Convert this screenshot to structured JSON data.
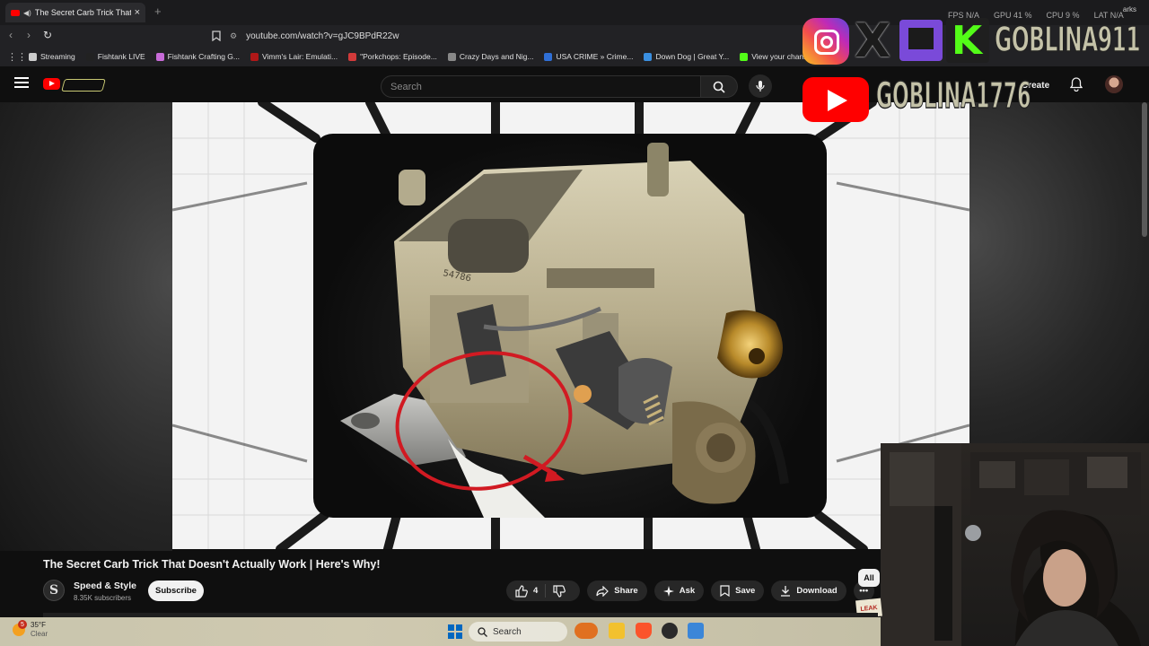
{
  "browser": {
    "tab_title": "The Secret Carb Trick That Doesn't Actually Work | Here's Why!",
    "url": "youtube.com/watch?v=gJC9BPdR22w",
    "bookmarks": [
      {
        "label": "Streaming",
        "color": "#cccccc"
      },
      {
        "label": "Fishtank LIVE",
        "color": "#222222"
      },
      {
        "label": "Fishtank Crafting G...",
        "color": "#c86bd8"
      },
      {
        "label": "Vimm's Lair: Emulati...",
        "color": "#b01818"
      },
      {
        "label": "\"Porkchops: Episode...",
        "color": "#d23a3a"
      },
      {
        "label": "Crazy Days and Nig...",
        "color": "#888888"
      },
      {
        "label": "USA CRIME » Crime...",
        "color": "#2f6fd6"
      },
      {
        "label": "Down Dog | Great Y...",
        "color": "#3a8fe0"
      },
      {
        "label": "View your channel",
        "color": "#53fc18"
      }
    ],
    "bookmarks_right": "arks"
  },
  "youtube": {
    "search_placeholder": "Search",
    "create_label": "Create"
  },
  "overlay": {
    "handle_primary": "GOBLINA911",
    "handle_youtube": "GOBLINA1776",
    "perf": {
      "fps": "FPS N/A",
      "gpu": "GPU 41 %",
      "cpu": "CPU 9 %",
      "lat": "LAT N/A"
    }
  },
  "video": {
    "title": "The Secret Carb Trick That Doesn't Actually Work | Here's Why!",
    "carb_part_number": "54786",
    "channel_name": "Speed & Style",
    "channel_initial": "S",
    "subscribers": "8.35K subscribers",
    "subscribe_label": "Subscribe",
    "likes": "4",
    "share_label": "Share",
    "ask_label": "Ask",
    "save_label": "Save",
    "download_label": "Download",
    "filter_chip": "All",
    "leak_badge": "LEAK"
  },
  "taskbar": {
    "temperature": "35°F",
    "condition": "Clear",
    "notification_count": "5",
    "search_label": "Search"
  },
  "colors": {
    "youtube_red": "#ff0000",
    "kick_green": "#53fc18",
    "twitch_purple": "#7a4ad9",
    "annotation_red": "#d11a22"
  }
}
